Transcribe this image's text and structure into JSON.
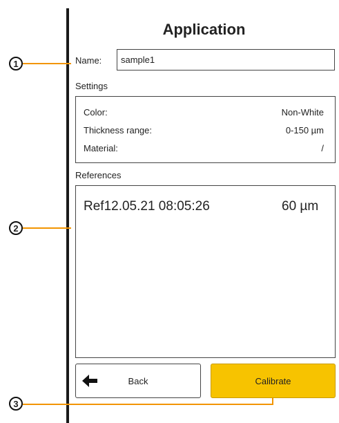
{
  "app": {
    "title": "Application"
  },
  "name_field": {
    "label": "Name:",
    "value": "sample1"
  },
  "settings": {
    "heading": "Settings",
    "rows": [
      {
        "label": "Color:",
        "value": "Non-White"
      },
      {
        "label": "Thickness range:",
        "value": "0-150 µm"
      },
      {
        "label": "Material:",
        "value": "/"
      }
    ]
  },
  "references": {
    "heading": "References",
    "items": [
      {
        "name": "Ref12.05.21 08:05:26",
        "value": "60 µm"
      }
    ]
  },
  "buttons": {
    "back": "Back",
    "calibrate": "Calibrate"
  },
  "callouts": [
    "1",
    "2",
    "3"
  ],
  "colors": {
    "accent": "#f7c300",
    "callout_line": "#f29400"
  },
  "icons": {
    "back": "arrow-left-icon"
  }
}
